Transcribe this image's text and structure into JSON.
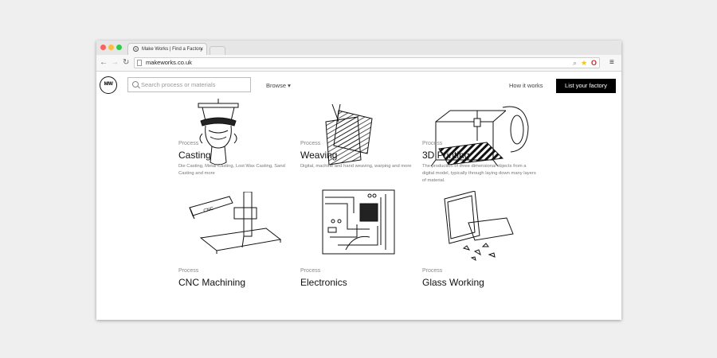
{
  "browser": {
    "tab_title": "Make Works | Find a Factory",
    "tab_favicon": "S",
    "tab_close": "×",
    "url": "makeworks.co.uk",
    "back": "←",
    "forward": "→",
    "reload": "↻",
    "menu": "≡"
  },
  "header": {
    "logo": "M/W",
    "search_placeholder": "Search process or materials",
    "browse": "Browse ▾",
    "how_it_works": "How it works",
    "list_factory": "List your factory"
  },
  "cards": [
    {
      "kicker": "Process",
      "title": "Casting",
      "desc": "Die Casting, Metal Casting, Lost Wax Casting, Sand Casting and more"
    },
    {
      "kicker": "Process",
      "title": "Weaving",
      "desc": "Digital, machine and hand weaving, warping and more"
    },
    {
      "kicker": "Process",
      "title": "3D Printing",
      "desc": "The production of three dimensional objects from a digital model, typically through laying down many layers of material."
    },
    {
      "kicker": "Process",
      "title": "CNC Machining",
      "desc": ""
    },
    {
      "kicker": "Process",
      "title": "Electronics",
      "desc": ""
    },
    {
      "kicker": "Process",
      "title": "Glass Working",
      "desc": ""
    }
  ],
  "colors": {
    "background": "#efefef",
    "cta_bg": "#000000",
    "cta_text": "#ffffff",
    "close_red": "#fc605c",
    "min_yellow": "#fdbc40",
    "max_green": "#34c84a"
  }
}
